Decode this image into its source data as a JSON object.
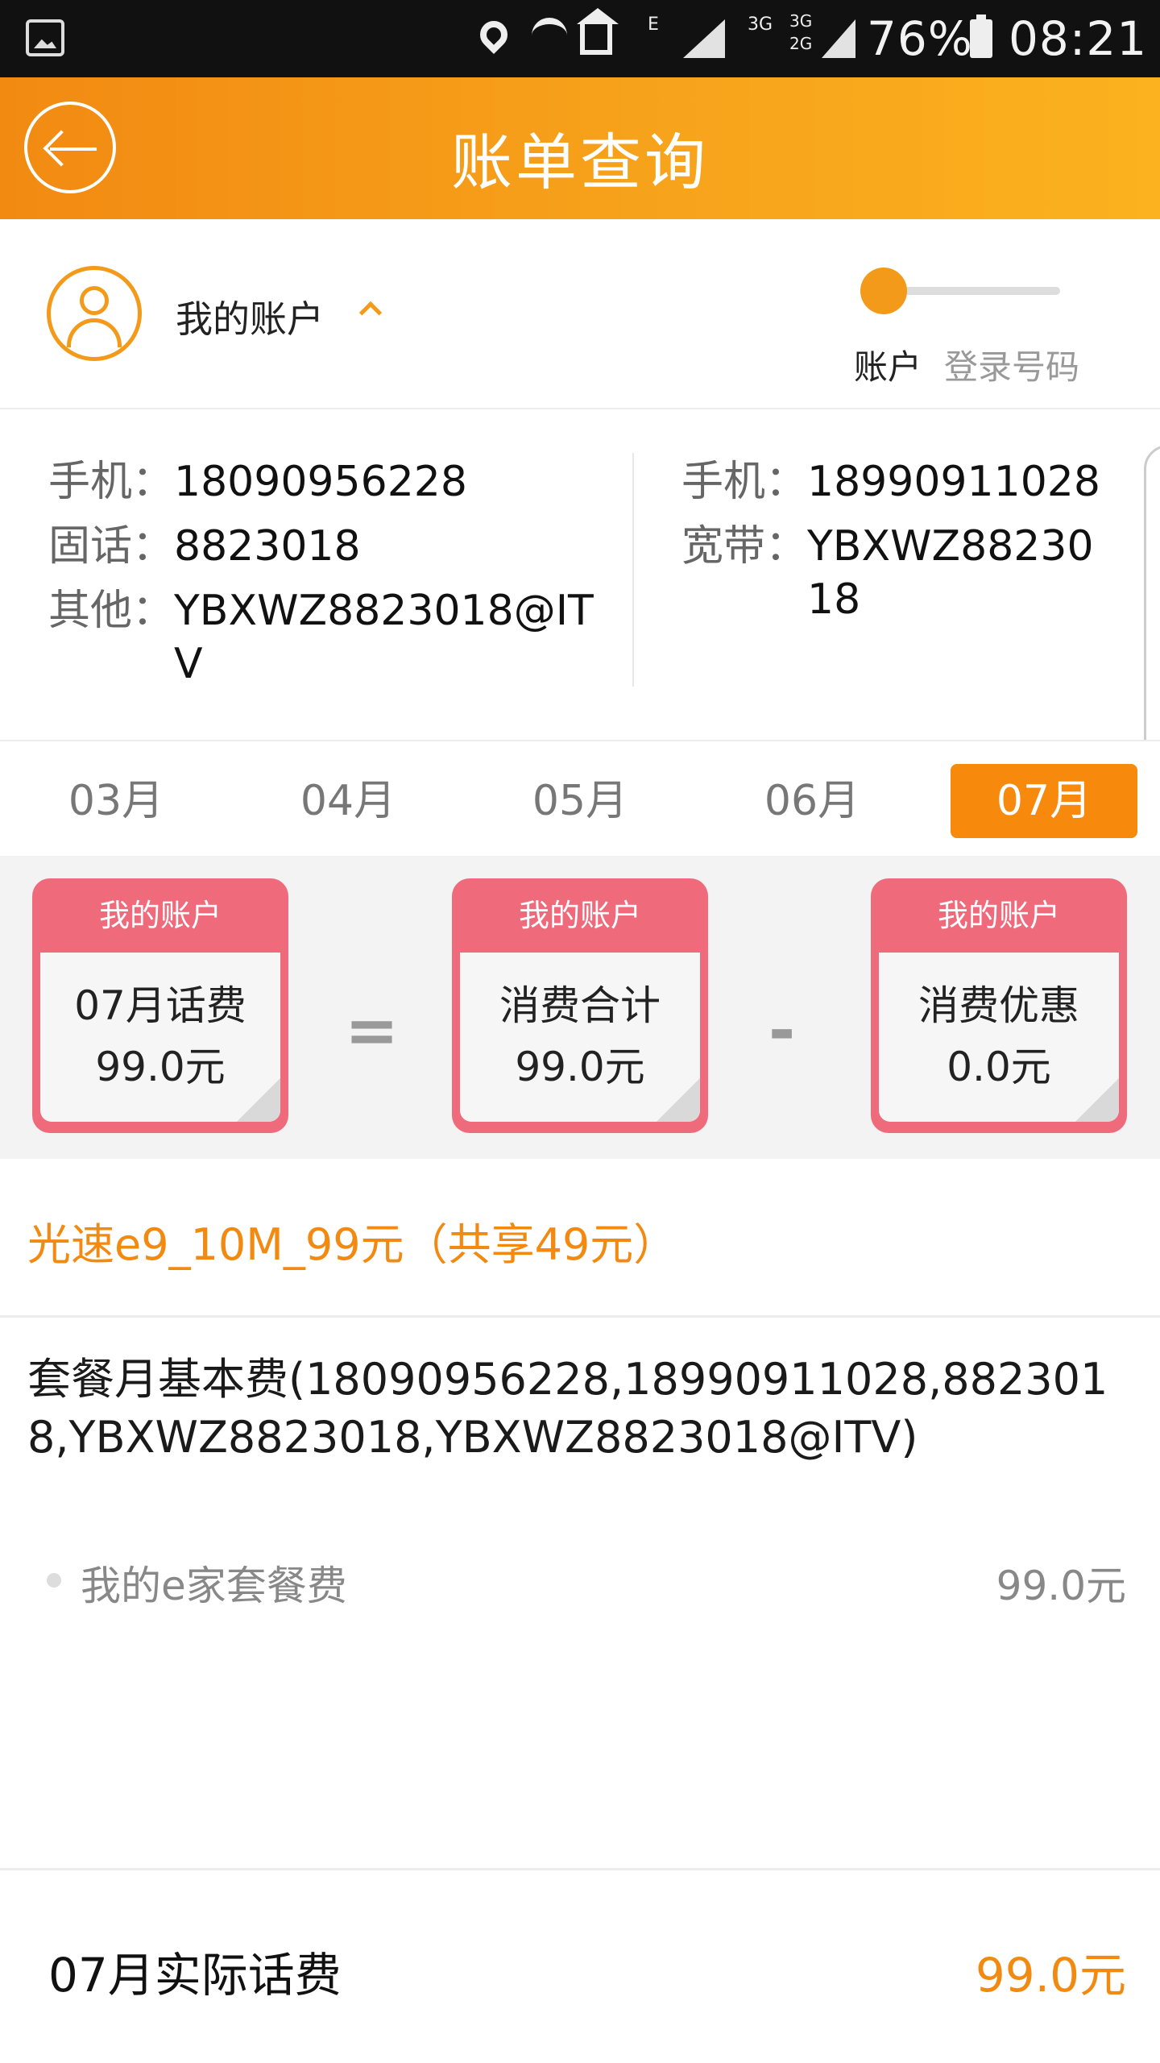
{
  "status_bar": {
    "network_e": "E",
    "network_3g": "3G",
    "dual_3g": "3G",
    "dual_2g": "2G",
    "battery": "76%",
    "time": "08:21"
  },
  "header": {
    "title": "账单查询"
  },
  "account": {
    "label": "我的账户",
    "toggle_on_label": "账户",
    "toggle_off_label": "登录号码"
  },
  "numbers": {
    "left": [
      {
        "key": "手机：",
        "value": "18090956228"
      },
      {
        "key": "固话：",
        "value": "8823018"
      },
      {
        "key": "其他：",
        "value": "YBXWZ8823018@ITV"
      }
    ],
    "right": [
      {
        "key": "手机：",
        "value": "18990911028"
      },
      {
        "key": "宽带：",
        "value": "YBXWZ8823018"
      }
    ]
  },
  "months": [
    "03月",
    "04月",
    "05月",
    "06月",
    "07月"
  ],
  "active_month_index": 4,
  "formula": {
    "cards": [
      {
        "head": "我的账户",
        "title": "07月话费",
        "amount": "99.0元"
      },
      {
        "head": "我的账户",
        "title": "消费合计",
        "amount": "99.0元"
      },
      {
        "head": "我的账户",
        "title": "消费优惠",
        "amount": "0.0元"
      }
    ],
    "op_equals": "=",
    "op_minus": "-"
  },
  "package": {
    "title": "光速e9_10M_99元（共享49元）",
    "fee_desc": "套餐月基本费(18090956228,18990911028,8823018,YBXWZ8823018,YBXWZ8823018@ITV)",
    "item_name": "我的e家套餐费",
    "item_amount": "99.0元"
  },
  "actual": {
    "label": "07月实际话费",
    "amount": "99.0元"
  },
  "colors": {
    "accent": "#f28a12",
    "card": "#ef6a7b"
  }
}
